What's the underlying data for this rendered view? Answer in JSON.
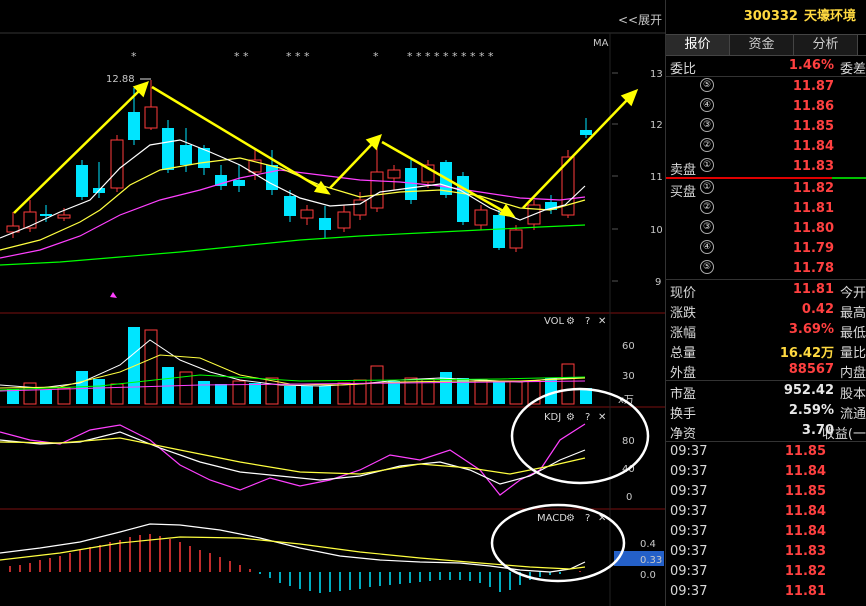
{
  "toolbar": {
    "expand_label": "<<展开",
    "ma_label": "MA"
  },
  "stock": {
    "code": "300332",
    "name": "天壕环境"
  },
  "tabs": [
    {
      "label": "报价"
    },
    {
      "label": "资金"
    },
    {
      "label": "分析"
    }
  ],
  "webi": {
    "label": "委比",
    "value": "1.46%",
    "suffix": "委差"
  },
  "sell_levels": [
    {
      "num": "⑤",
      "price": "11.87"
    },
    {
      "num": "④",
      "price": "11.86"
    },
    {
      "num": "③",
      "price": "11.85"
    },
    {
      "num": "②",
      "price": "11.84"
    },
    {
      "num": "①",
      "price": "11.83",
      "label": "卖盘"
    }
  ],
  "buy_levels": [
    {
      "num": "①",
      "price": "11.82",
      "label": "买盘"
    },
    {
      "num": "②",
      "price": "11.81"
    },
    {
      "num": "③",
      "price": "11.80"
    },
    {
      "num": "④",
      "price": "11.79"
    },
    {
      "num": "⑤",
      "price": "11.78"
    }
  ],
  "quote": [
    {
      "label": "现价",
      "value": "11.81",
      "suffix": "今开",
      "color": "#ff4040"
    },
    {
      "label": "涨跌",
      "value": "0.42",
      "suffix": "最高",
      "color": "#ff4040"
    },
    {
      "label": "涨幅",
      "value": "3.69%",
      "suffix": "最低",
      "color": "#ff4040"
    },
    {
      "label": "总量",
      "value": "16.42万",
      "suffix": "量比",
      "color": "#ffd940"
    },
    {
      "label": "外盘",
      "value": "88567",
      "suffix": "内盘",
      "color": "#ff4040"
    }
  ],
  "fundamentals": [
    {
      "label": "市盈",
      "value": "952.42",
      "suffix": "股本"
    },
    {
      "label": "换手",
      "value": "2.59%",
      "suffix": "流通"
    },
    {
      "label": "净资",
      "value": "3.70",
      "suffix": "收益(一"
    }
  ],
  "trades": [
    {
      "time": "09:37",
      "price": "11.85"
    },
    {
      "time": "09:37",
      "price": "11.84"
    },
    {
      "time": "09:37",
      "price": "11.85"
    },
    {
      "time": "09:37",
      "price": "11.84"
    },
    {
      "time": "09:37",
      "price": "11.84"
    },
    {
      "time": "09:37",
      "price": "11.83"
    },
    {
      "time": "09:37",
      "price": "11.82"
    },
    {
      "time": "09:37",
      "price": "11.81"
    }
  ],
  "chart": {
    "price_ticks": [
      "13",
      "12",
      "11",
      "10",
      "9"
    ],
    "vol_ticks": [
      "60",
      "30"
    ],
    "vol_unit": "x万",
    "kdj_ticks": [
      "80",
      "40",
      "0"
    ],
    "macd_ticks": [
      "0.4",
      "0.0"
    ],
    "macd_badge": "0.33",
    "high_label": "12.88",
    "vol_label": "VOL",
    "kdj_label": "KDJ",
    "macd_label": "MACD",
    "help": "?",
    "close": "✕"
  },
  "colors": {
    "up": "#ff3b3b",
    "down": "#00e5ff",
    "ma5": "#ffffff",
    "ma10": "#ffff40",
    "ma20": "#ff40ff",
    "ma60": "#00ff00",
    "arrow": "#ffff00"
  }
}
